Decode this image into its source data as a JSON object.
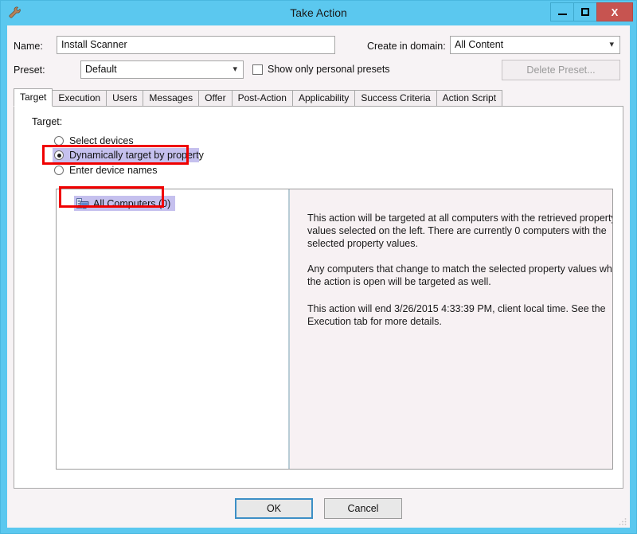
{
  "window": {
    "title": "Take Action",
    "icon": "wrench-icon",
    "minimize_label": "Minimize",
    "maximize_label": "Maximize",
    "close_label": "X"
  },
  "form": {
    "name_label": "Name:",
    "name_value": "Install Scanner",
    "domain_label": "Create in domain:",
    "domain_value": "All Content",
    "preset_label": "Preset:",
    "preset_value": "Default",
    "show_personal_presets_label": "Show only personal presets",
    "delete_preset_label": "Delete Preset..."
  },
  "tabs": [
    {
      "label": "Target",
      "active": true
    },
    {
      "label": "Execution",
      "active": false
    },
    {
      "label": "Users",
      "active": false
    },
    {
      "label": "Messages",
      "active": false
    },
    {
      "label": "Offer",
      "active": false
    },
    {
      "label": "Post-Action",
      "active": false
    },
    {
      "label": "Applicability",
      "active": false
    },
    {
      "label": "Success Criteria",
      "active": false
    },
    {
      "label": "Action Script",
      "active": false
    }
  ],
  "target": {
    "group_label": "Target:",
    "options": [
      {
        "label": "Select devices",
        "selected": false
      },
      {
        "label": "Dynamically target by property",
        "selected": true
      },
      {
        "label": "Enter device names",
        "selected": false
      }
    ],
    "tree": {
      "item_label": "All Computers (0)",
      "item_icon": "computer-icon",
      "selected": true
    },
    "description": {
      "paragraph1": "This action will be targeted at all computers with the retrieved property values selected on the left. There are currently 0 computers with the selected property values.",
      "paragraph2": "Any computers that change to match the selected property values while the action is open will be targeted as well.",
      "paragraph3": "This action will end 3/26/2015 4:33:39 PM, client local time. See the Execution tab for more details."
    }
  },
  "footer": {
    "ok_label": "OK",
    "cancel_label": "Cancel"
  },
  "colors": {
    "titlebar": "#5bc8ef",
    "close_button": "#c75450",
    "selection_highlight": "#c5c0ee",
    "annotation": "#f00000",
    "dialog_bg": "#f7f3f5"
  }
}
